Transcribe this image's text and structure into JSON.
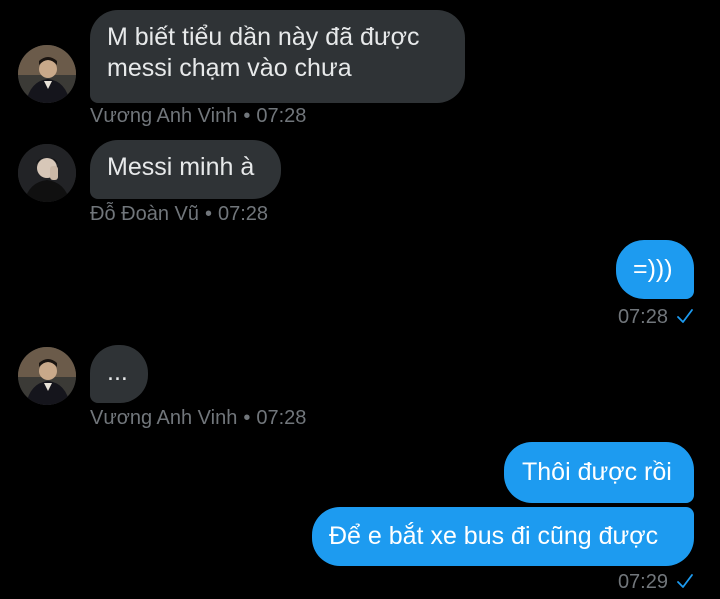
{
  "conversation": {
    "messages": [
      {
        "direction": "in",
        "text": "M biết tiểu dần này đã được\nmessi chạm vào chưa",
        "sender": "Vương Anh Vinh",
        "time": "07:28"
      },
      {
        "direction": "in",
        "text": "Messi minh à",
        "sender": "Đỗ Đoàn Vũ",
        "time": "07:28"
      },
      {
        "direction": "out",
        "text": "=)))",
        "time": "07:28"
      },
      {
        "direction": "in",
        "text": "...",
        "sender": "Vương Anh Vinh",
        "time": "07:28"
      },
      {
        "direction": "out",
        "text": "Thôi được rồi",
        "time": ""
      },
      {
        "direction": "out",
        "text": "Để e bắt xe bus đi cũng được",
        "time": "07:29"
      }
    ]
  },
  "meta_separator": "•",
  "colors": {
    "background": "#000000",
    "incoming_bubble": "#2f3336",
    "outgoing_bubble": "#1d9bf0",
    "meta_text": "#71767b",
    "read_check": "#1d9bf0"
  },
  "icons": {
    "read_receipt": "checkmark-icon"
  }
}
